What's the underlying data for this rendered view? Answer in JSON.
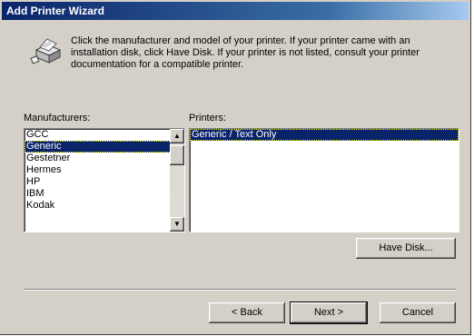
{
  "window": {
    "title": "Add Printer Wizard"
  },
  "header": {
    "icon": "printer-icon",
    "instruction": "Click the manufacturer and model of your printer. If your printer came with an\ninstallation disk, click Have Disk. If your printer is not listed, consult your printer\ndocumentation for a compatible printer."
  },
  "manufacturers": {
    "label": "Manufacturers:",
    "items": [
      "GCC",
      "Generic",
      "Gestetner",
      "Hermes",
      "HP",
      "IBM",
      "Kodak"
    ],
    "selected": "Generic"
  },
  "printers": {
    "label": "Printers:",
    "items": [
      "Generic / Text Only"
    ],
    "selected": "Generic / Text Only"
  },
  "buttons": {
    "have_disk": "Have Disk...",
    "back": "< Back",
    "next": "Next >",
    "cancel": "Cancel"
  },
  "colors": {
    "selection": "#0a246a",
    "face": "#d4d0c8"
  }
}
